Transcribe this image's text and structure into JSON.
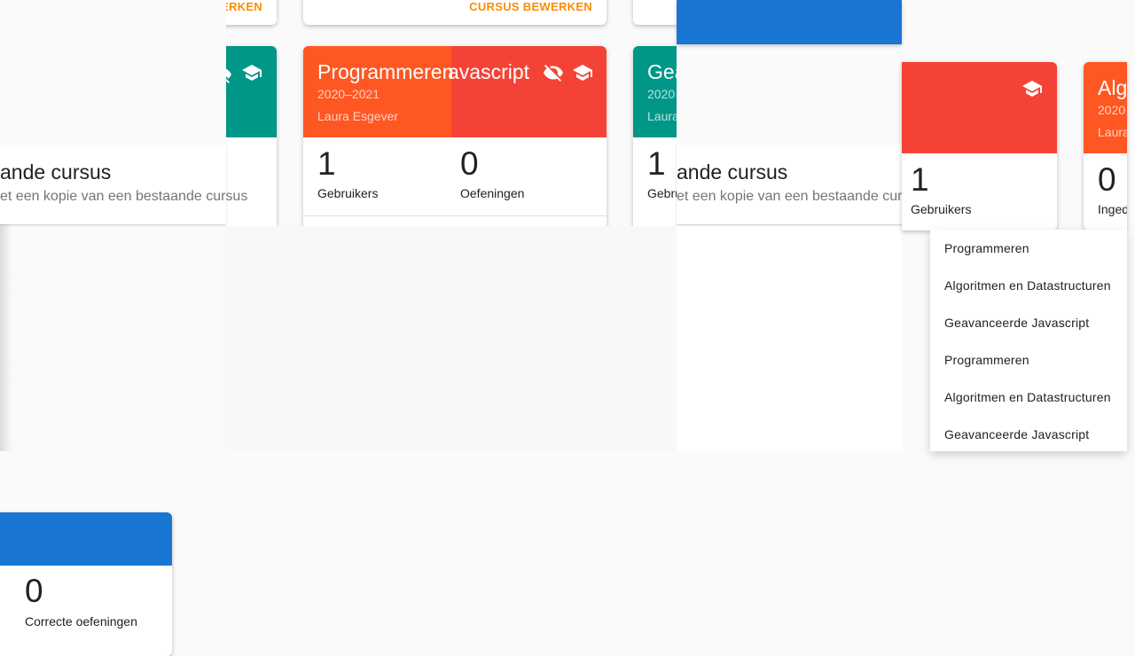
{
  "colors": {
    "orange": "#ff5722",
    "red": "#f44336",
    "teal": "#009688",
    "blue": "#1976d2",
    "accent": "#fb8c00"
  },
  "action_label": "CURSUS BEWERKEN",
  "action_label_cut": "ERKEN",
  "copy_overlay": {
    "title": "ande cursus",
    "description": "et een kopie van een bestaande cursus"
  },
  "card_main": {
    "title": "Programmeren",
    "title_overlap": "avascript",
    "year": "2020–2021",
    "teacher": "Laura Esgever",
    "stats": [
      {
        "value": "1",
        "label": "Gebruikers"
      },
      {
        "value": "0",
        "label": "Oefeningen"
      }
    ]
  },
  "card_geav": {
    "title_cut": "Gea",
    "year_cut": "2020",
    "teacher_cut": "Laura",
    "stat_value": "1",
    "stat_label_cut": "Gebru"
  },
  "card_right_red": {
    "stat_value": "1",
    "stat_label": "Gebruikers"
  },
  "card_far_right": {
    "title_cut": "Alg",
    "year_cut": "2020",
    "teacher_cut": "Laura",
    "stat_value": "0",
    "stat_label_cut": "Inged"
  },
  "card_bottom": {
    "stat_value": "0",
    "stat_label": "Correcte oefeningen"
  },
  "dropdown": {
    "items": [
      "Programmeren",
      "Algoritmen en Datastructuren",
      "Geavanceerde Javascript",
      "Programmeren",
      "Algoritmen en Datastructuren",
      "Geavanceerde Javascript"
    ]
  }
}
